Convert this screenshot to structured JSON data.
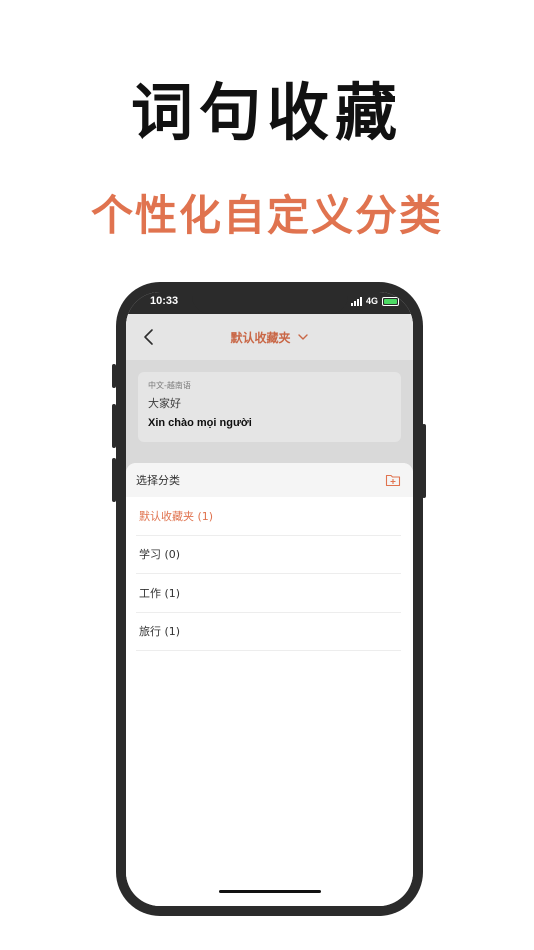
{
  "promo": {
    "title": "词句收藏",
    "subtitle": "个性化自定义分类"
  },
  "status_bar": {
    "time": "10:33",
    "network": "4G"
  },
  "nav": {
    "title": "默认收藏夹"
  },
  "card": {
    "language_pair": "中文-越南语",
    "source_text": "大家好",
    "target_text": "Xin chào mọi người"
  },
  "sheet": {
    "title": "选择分类",
    "categories": [
      {
        "label": "默认收藏夹 (1)",
        "selected": true
      },
      {
        "label": "学习 (0)",
        "selected": false
      },
      {
        "label": "工作 (1)",
        "selected": false
      },
      {
        "label": "旅行 (1)",
        "selected": false
      }
    ]
  },
  "colors": {
    "accent": "#e0734f",
    "phone_frame": "#2b2b2b",
    "battery": "#4cd964"
  },
  "icons": [
    "back-chevron-icon",
    "chevron-down-icon",
    "add-folder-icon",
    "signal-icon",
    "battery-icon"
  ]
}
